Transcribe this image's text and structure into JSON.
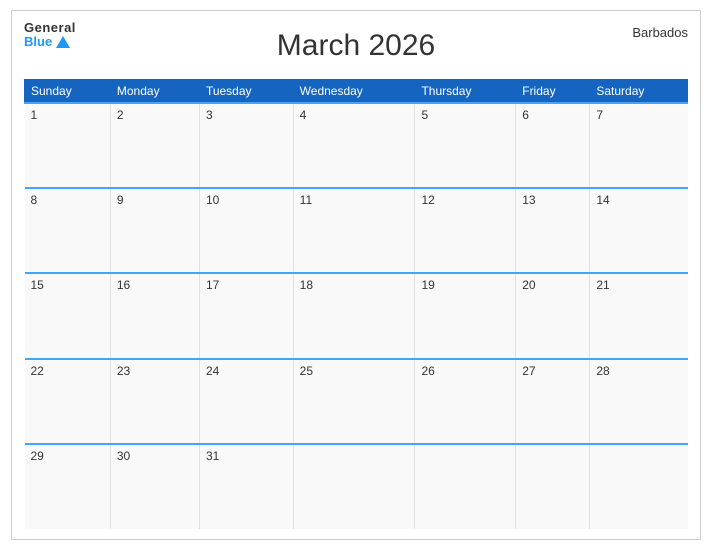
{
  "header": {
    "title": "March 2026",
    "country": "Barbados",
    "logo": {
      "general": "General",
      "blue": "Blue"
    }
  },
  "weekdays": [
    "Sunday",
    "Monday",
    "Tuesday",
    "Wednesday",
    "Thursday",
    "Friday",
    "Saturday"
  ],
  "weeks": [
    [
      1,
      2,
      3,
      4,
      5,
      6,
      7
    ],
    [
      8,
      9,
      10,
      11,
      12,
      13,
      14
    ],
    [
      15,
      16,
      17,
      18,
      19,
      20,
      21
    ],
    [
      22,
      23,
      24,
      25,
      26,
      27,
      28
    ],
    [
      29,
      30,
      31,
      null,
      null,
      null,
      null
    ]
  ]
}
